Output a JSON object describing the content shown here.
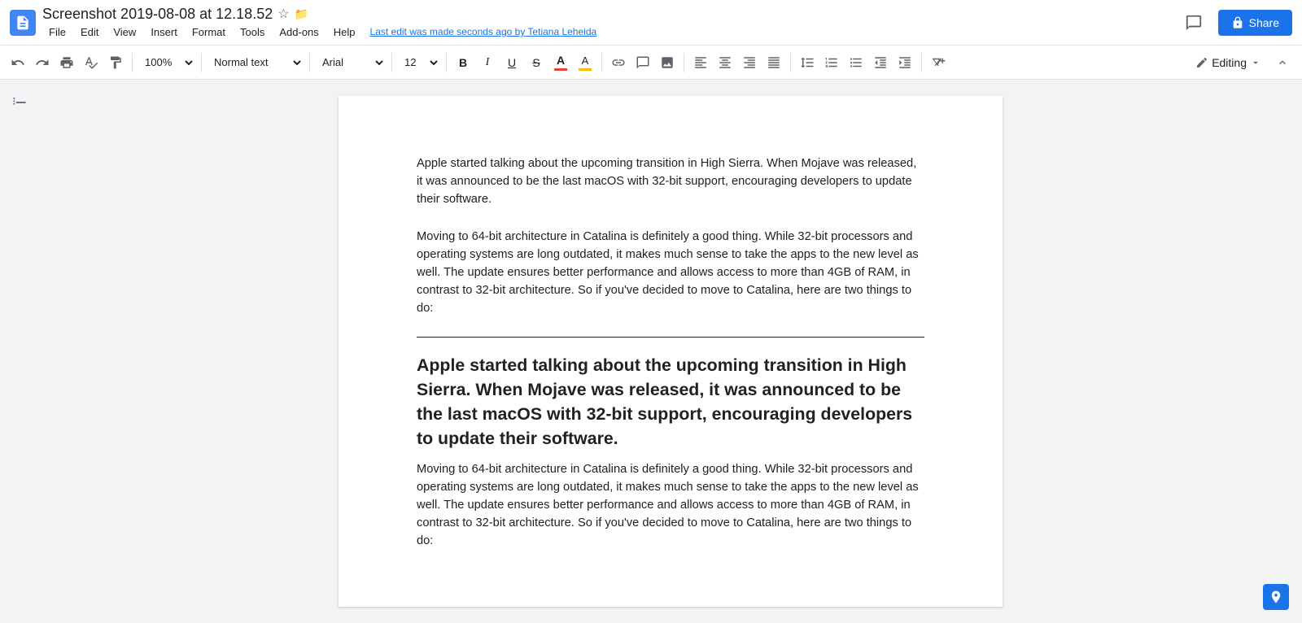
{
  "header": {
    "doc_title": "Screenshot 2019-08-08 at 12.18.52",
    "last_edit": "Last edit was made seconds ago by Tetiana Leheida",
    "share_label": "Share",
    "comment_icon": "💬",
    "star_icon": "☆",
    "folder_icon": "📁"
  },
  "menu": {
    "items": [
      "File",
      "Edit",
      "View",
      "Insert",
      "Format",
      "Tools",
      "Add-ons",
      "Help"
    ]
  },
  "toolbar": {
    "undo_label": "↩",
    "redo_label": "↪",
    "print_label": "🖨",
    "paint_format_label": "🖌",
    "zoom_value": "100%",
    "style_value": "Normal text",
    "font_value": "Arial",
    "size_value": "12",
    "bold_label": "B",
    "italic_label": "I",
    "underline_label": "U",
    "strikethrough_label": "S",
    "link_label": "🔗",
    "image_label": "🖼",
    "align_left": "≡",
    "align_center": "≡",
    "align_right": "≡",
    "align_justify": "≡",
    "line_spacing": "↕",
    "numbered_list": "1.",
    "bulleted_list": "•",
    "decrease_indent": "←",
    "increase_indent": "→",
    "clear_format": "✕",
    "editing_label": "Editing",
    "pencil_icon": "✏"
  },
  "document": {
    "paragraph1": "Apple started talking about the upcoming transition in High Sierra. When Mojave was released, it was announced to be the last macOS with 32-bit support, encouraging developers to update their software.",
    "paragraph2": "Moving to 64-bit architecture in Catalina is definitely a good thing. While 32-bit processors and operating systems are long outdated, it makes much sense to take the apps to the new level as well. The update ensures better performance and allows access to more than 4GB of RAM, in contrast to 32-bit architecture. So if you've decided to move to Catalina, here are two things to do:",
    "heading": "Apple started talking about the upcoming transition in High Sierra. When Mojave was released, it was announced to be the last macOS with 32-bit support, encouraging developers to update their software.",
    "paragraph3": "Moving to 64-bit architecture in Catalina is definitely a good thing. While 32-bit processors and operating systems are long outdated, it makes much sense to take the apps to the new level as well. The update ensures better performance and allows access to more than 4GB of RAM, in contrast to 32-bit architecture. So if you've decided to move to Catalina, here are two things to do:"
  }
}
